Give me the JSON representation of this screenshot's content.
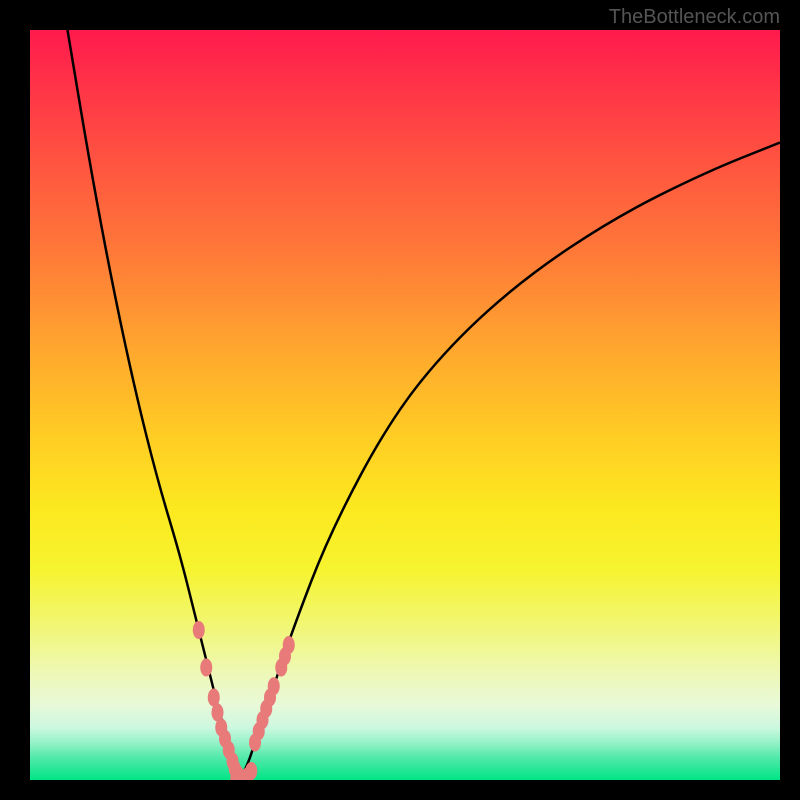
{
  "watermark": "TheBottleneck.com",
  "chart_data": {
    "type": "line",
    "title": "",
    "xlabel": "",
    "ylabel": "",
    "xlim": [
      0,
      100
    ],
    "ylim": [
      0,
      100
    ],
    "left_curve": {
      "x": [
        5,
        8,
        11,
        14,
        17,
        20,
        22,
        24,
        25.5,
        27,
        27.5,
        28
      ],
      "y": [
        100,
        82,
        66,
        52,
        40,
        30,
        22,
        14,
        8,
        4,
        1.5,
        0.2
      ]
    },
    "right_curve": {
      "x": [
        28,
        29,
        30,
        32,
        35,
        40,
        48,
        56,
        66,
        78,
        90,
        100
      ],
      "y": [
        0.2,
        2,
        5,
        11,
        20,
        33,
        48,
        58,
        67,
        75,
        81,
        85
      ]
    },
    "valley_x": 28,
    "data_points_left": [
      {
        "x": 22.5,
        "y": 20
      },
      {
        "x": 23.5,
        "y": 15
      },
      {
        "x": 24.5,
        "y": 11
      },
      {
        "x": 25,
        "y": 9
      },
      {
        "x": 25.5,
        "y": 7
      },
      {
        "x": 26,
        "y": 5.5
      },
      {
        "x": 26.5,
        "y": 4
      },
      {
        "x": 27,
        "y": 2.5
      },
      {
        "x": 27.3,
        "y": 1.5
      },
      {
        "x": 27.7,
        "y": 0.8
      }
    ],
    "data_points_right": [
      {
        "x": 30,
        "y": 5
      },
      {
        "x": 30.5,
        "y": 6.5
      },
      {
        "x": 31,
        "y": 8
      },
      {
        "x": 31.5,
        "y": 9.5
      },
      {
        "x": 32,
        "y": 11
      },
      {
        "x": 32.5,
        "y": 12.5
      },
      {
        "x": 33.5,
        "y": 15
      },
      {
        "x": 34,
        "y": 16.5
      },
      {
        "x": 34.5,
        "y": 18
      }
    ],
    "data_points_bottom": [
      {
        "x": 27.5,
        "y": 0.2
      },
      {
        "x": 28,
        "y": 0.1
      },
      {
        "x": 28.5,
        "y": 0.2
      },
      {
        "x": 29,
        "y": 0.5
      },
      {
        "x": 29.5,
        "y": 1.2
      }
    ]
  },
  "colors": {
    "gradient_top": "#ff1a4d",
    "gradient_bottom": "#00e585",
    "curve": "#000000",
    "points": "#e87a7a",
    "background": "#000000"
  }
}
